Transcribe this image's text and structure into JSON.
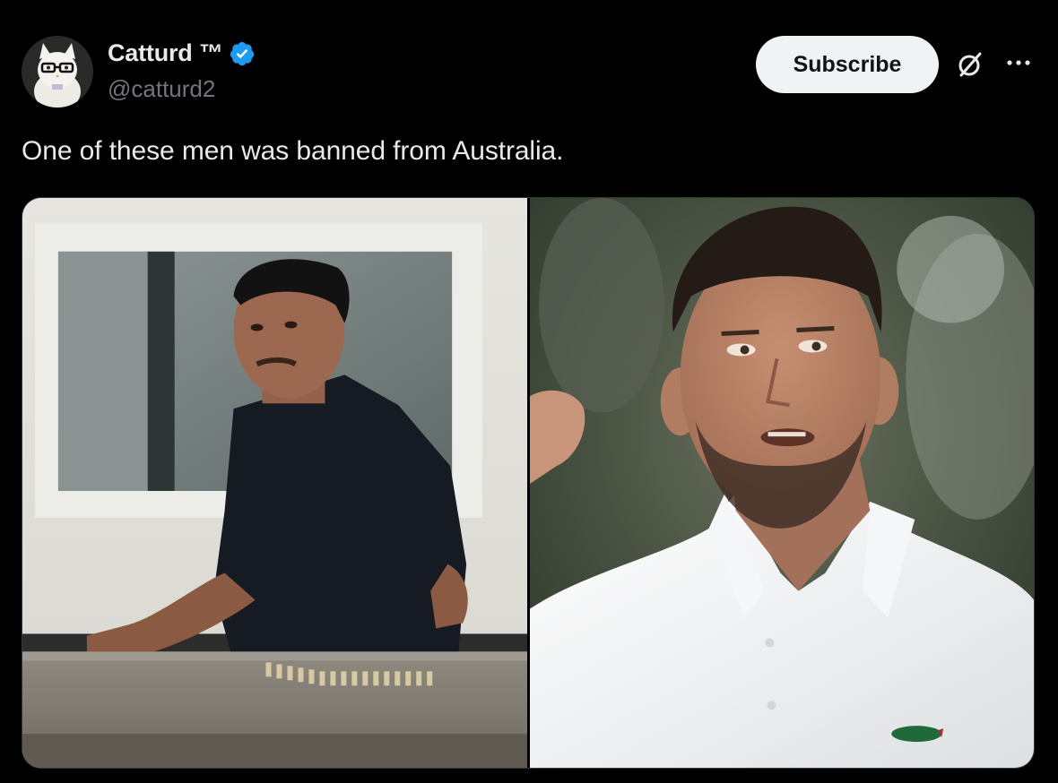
{
  "author": {
    "display_name": "Catturd ™",
    "handle": "@catturd2",
    "verified": true,
    "verified_color": "#1d9bf0"
  },
  "actions": {
    "subscribe_label": "Subscribe",
    "grok_icon": "grok-slash-circle-icon",
    "more_icon": "more-dots-icon"
  },
  "post": {
    "text": "One of these men was banned from Australia."
  },
  "media": {
    "images": [
      {
        "subject": "man in black shirt on rooftop ledge"
      },
      {
        "subject": "tennis player in white polo clenching fist"
      }
    ]
  },
  "colors": {
    "background": "#000000",
    "text_primary": "#e7e9ea",
    "text_secondary": "#71767b",
    "button_bg": "#eff3f4",
    "button_text": "#0f1419"
  }
}
